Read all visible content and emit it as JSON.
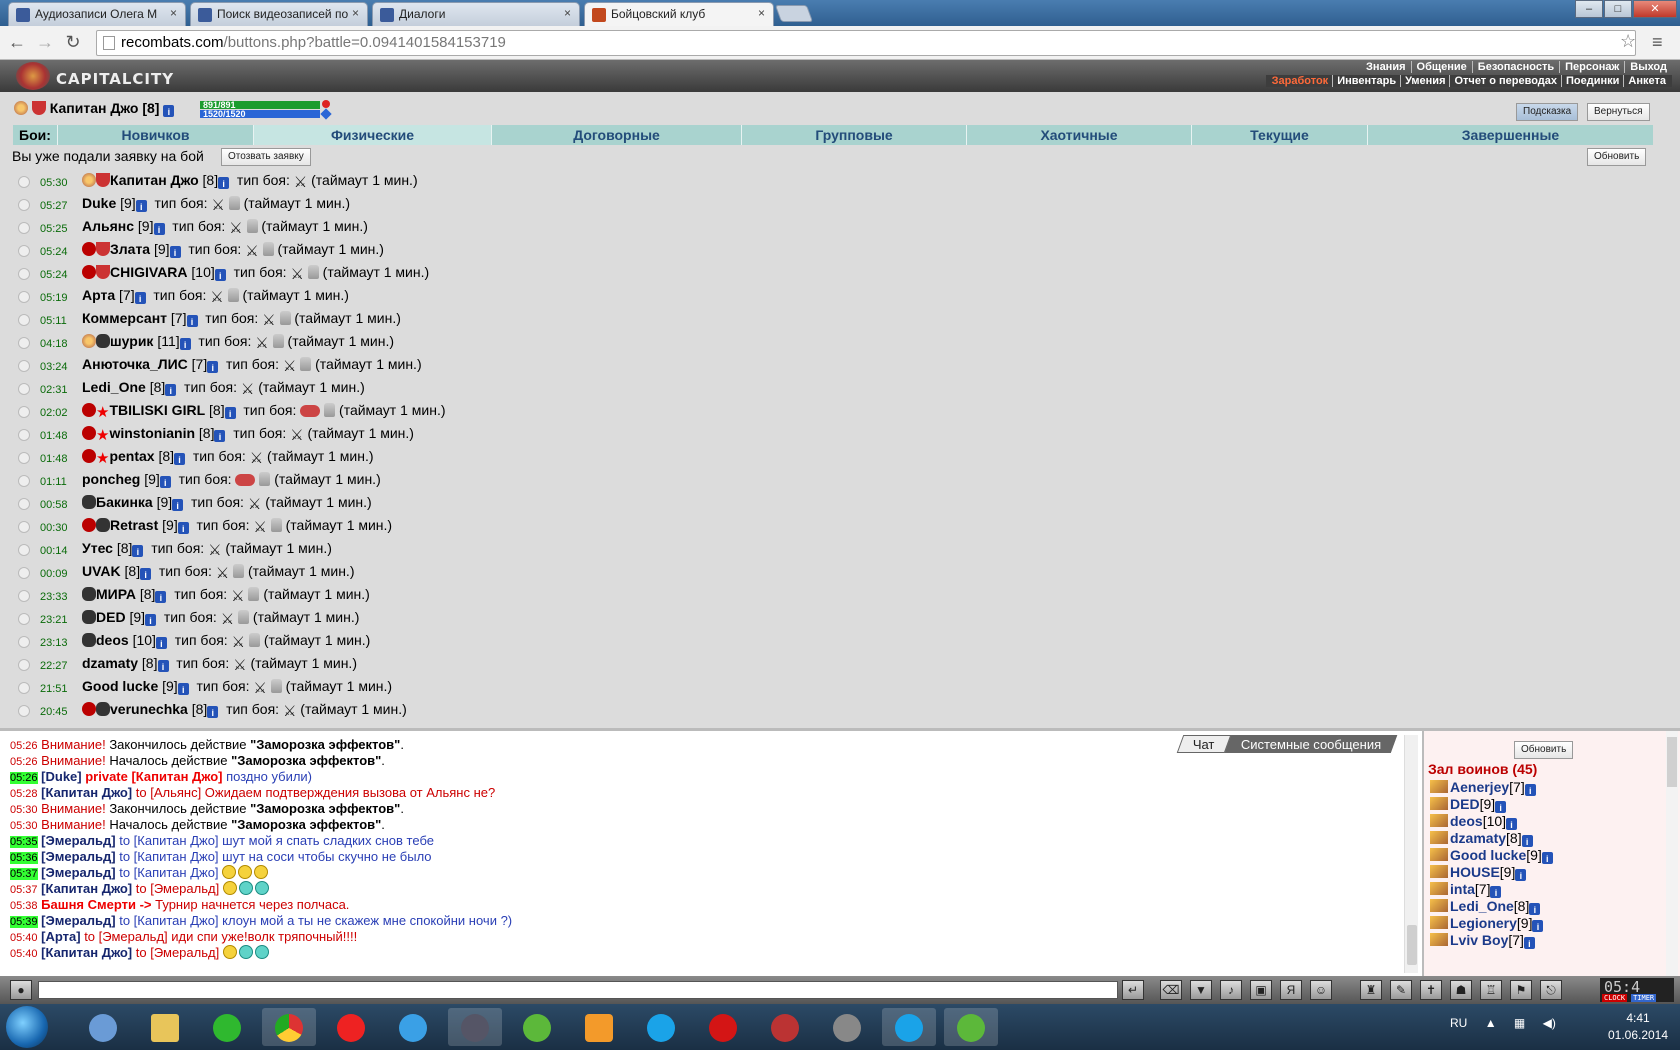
{
  "browser": {
    "tabs": [
      {
        "title": "Аудиозаписи Олега М",
        "active": false
      },
      {
        "title": "Поиск видеозаписей по",
        "active": false
      },
      {
        "title": "Диалоги",
        "active": false
      },
      {
        "title": "Бойцовский клуб",
        "active": true
      }
    ],
    "url_domain": "recombats.com",
    "url_path": "/buttons.php?battle=0.0941401584153719"
  },
  "game": {
    "logo": "CAPITALCITY",
    "topnav_row1": [
      "Знания",
      "Общение",
      "Безопасность",
      "Персонаж",
      "Выход"
    ],
    "topnav_row2": [
      "Заработок",
      "Инвентарь",
      "Умения",
      "Отчет о переводах",
      "Поединки",
      "Анкета"
    ],
    "player": {
      "name": "Капитан Джо",
      "level": "[8]",
      "hp": "891/891",
      "mana": "1520/1520"
    },
    "buttons": {
      "hint": "Подсказка",
      "back": "Вернуться",
      "refresh": "Обновить",
      "withdraw": "Отозвать заявку"
    },
    "fight_label": "Бои:",
    "fight_tabs": [
      "Новичков",
      "Физические",
      "Договорные",
      "Групповые",
      "Хаотичные",
      "Текущие",
      "Завершенные"
    ],
    "notice": "Вы уже подали заявку на бой",
    "fight_type_label": "тип боя:",
    "timeout_text": "(таймаут 1 мин.)",
    "fights": [
      {
        "time": "05:30",
        "name": "Капитан Джо",
        "level": "[8]",
        "icons": "sun-shield",
        "locked": false,
        "fist": false
      },
      {
        "time": "05:27",
        "name": "Duke",
        "level": "[9]",
        "icons": "",
        "locked": true,
        "fist": false
      },
      {
        "time": "05:25",
        "name": "Альянс",
        "level": "[9]",
        "icons": "",
        "locked": true,
        "fist": false
      },
      {
        "time": "05:24",
        "name": "Злата",
        "level": "[9]",
        "icons": "cross-shield",
        "locked": true,
        "fist": false
      },
      {
        "time": "05:24",
        "name": "CHIGIVARA",
        "level": "[10]",
        "icons": "cross-shield",
        "locked": true,
        "fist": false
      },
      {
        "time": "05:19",
        "name": "Арта",
        "level": "[7]",
        "icons": "",
        "locked": true,
        "fist": false
      },
      {
        "time": "05:11",
        "name": "Коммерсант",
        "level": "[7]",
        "icons": "",
        "locked": true,
        "fist": false
      },
      {
        "time": "04:18",
        "name": "шурик",
        "level": "[11]",
        "icons": "sun-mask",
        "locked": true,
        "fist": false
      },
      {
        "time": "03:24",
        "name": "Анюточка_ЛИС",
        "level": "[7]",
        "icons": "",
        "locked": true,
        "fist": false
      },
      {
        "time": "02:31",
        "name": "Ledi_One",
        "level": "[8]",
        "icons": "",
        "locked": false,
        "fist": false
      },
      {
        "time": "02:02",
        "name": "TBILISKI GIRL",
        "level": "[8]",
        "icons": "cross-star",
        "locked": true,
        "fist": true
      },
      {
        "time": "01:48",
        "name": "winstonianin",
        "level": "[8]",
        "icons": "cross-star",
        "locked": false,
        "fist": false
      },
      {
        "time": "01:48",
        "name": "pentax",
        "level": "[8]",
        "icons": "cross-star",
        "locked": false,
        "fist": false
      },
      {
        "time": "01:11",
        "name": "poncheg",
        "level": "[9]",
        "icons": "",
        "locked": true,
        "fist": true
      },
      {
        "time": "00:58",
        "name": "Бакинка",
        "level": "[9]",
        "icons": "mask",
        "locked": false,
        "fist": false
      },
      {
        "time": "00:30",
        "name": "Retrast",
        "level": "[9]",
        "icons": "cross-mask",
        "locked": true,
        "fist": false
      },
      {
        "time": "00:14",
        "name": "Утес",
        "level": "[8]",
        "icons": "",
        "locked": false,
        "fist": false
      },
      {
        "time": "00:09",
        "name": "UVAK",
        "level": "[8]",
        "icons": "",
        "locked": true,
        "fist": false
      },
      {
        "time": "23:33",
        "name": "МИРА",
        "level": "[8]",
        "icons": "mask",
        "locked": true,
        "fist": false
      },
      {
        "time": "23:21",
        "name": "DED",
        "level": "[9]",
        "icons": "mask",
        "locked": true,
        "fist": false
      },
      {
        "time": "23:13",
        "name": "deos",
        "level": "[10]",
        "icons": "mask",
        "locked": true,
        "fist": false
      },
      {
        "time": "22:27",
        "name": "dzamaty",
        "level": "[8]",
        "icons": "",
        "locked": false,
        "fist": false
      },
      {
        "time": "21:51",
        "name": "Good lucke",
        "level": "[9]",
        "icons": "",
        "locked": true,
        "fist": false
      },
      {
        "time": "20:45",
        "name": "verunechka",
        "level": "[8]",
        "icons": "cross-mask",
        "locked": false,
        "fist": false
      }
    ]
  },
  "chat": {
    "tabs": [
      "Чат",
      "Системные сообщения"
    ],
    "lines": [
      {
        "time": "05:26",
        "hl": false,
        "kind": "system",
        "label": "Внимание!",
        "text": " Закончилось действие ",
        "bold": "\"Заморозка эффектов\"",
        "end": "."
      },
      {
        "time": "05:26",
        "hl": false,
        "kind": "system",
        "label": "Внимание!",
        "text": " Началось действие ",
        "bold": "\"Заморозка эффектов\"",
        "end": "."
      },
      {
        "time": "05:26",
        "hl": true,
        "kind": "private",
        "from": "[Duke]",
        "to": "private [Капитан Джо]",
        "text": " поздно убили)"
      },
      {
        "time": "05:28",
        "hl": false,
        "kind": "msg",
        "from": "[Капитан Джо]",
        "to": " to [Альянс]",
        "text": " Ожидаем подтверждения вызова от Альянс не?",
        "red": true
      },
      {
        "time": "05:30",
        "hl": false,
        "kind": "system",
        "label": "Внимание!",
        "text": " Закончилось действие ",
        "bold": "\"Заморозка эффектов\"",
        "end": "."
      },
      {
        "time": "05:30",
        "hl": false,
        "kind": "system",
        "label": "Внимание!",
        "text": " Началось действие ",
        "bold": "\"Заморозка эффектов\"",
        "end": "."
      },
      {
        "time": "05:35",
        "hl": true,
        "kind": "msg",
        "from": "[Эмеральд]",
        "to": " to [Капитан Джо]",
        "text": " шут мой я спать сладких снов тебе"
      },
      {
        "time": "05:36",
        "hl": true,
        "kind": "msg",
        "from": "[Эмеральд]",
        "to": " to [Капитан Джо]",
        "text": " шут на соси чтобы скучно не было"
      },
      {
        "time": "05:37",
        "hl": true,
        "kind": "msg",
        "from": "[Эмеральд]",
        "to": " to [Капитан Джо]",
        "text": " ",
        "smiles": 3
      },
      {
        "time": "05:37",
        "hl": false,
        "kind": "msg",
        "from": "[Капитан Джо]",
        "to": " to [Эмеральд]",
        "text": " ",
        "smiles": 3,
        "red": true
      },
      {
        "time": "05:38",
        "hl": false,
        "kind": "tower",
        "from": "Башня Смерти ->",
        "text": " Турнир начнется через полчаса."
      },
      {
        "time": "05:39",
        "hl": true,
        "kind": "msg",
        "from": "[Эмеральд]",
        "to": " to [Капитан Джо]",
        "text": " клоун мой а ты не скажеж мне спокойни ночи ?)"
      },
      {
        "time": "05:40",
        "hl": false,
        "kind": "msg",
        "from": "[Арта]",
        "to": " to [Эмеральд]",
        "text": " иди спи уже!волк тряпочный!!!!",
        "red": true
      },
      {
        "time": "05:40",
        "hl": false,
        "kind": "msg",
        "from": "[Капитан Джо]",
        "to": " to [Эмеральд]",
        "text": " ",
        "smiles": 3,
        "red": true
      }
    ]
  },
  "userlist": {
    "refresh": "Обновить",
    "title": "Зал воинов (45)",
    "users": [
      {
        "name": "Aenerjey",
        "level": "[7]"
      },
      {
        "name": "DED",
        "level": "[9]"
      },
      {
        "name": "deos",
        "level": "[10]"
      },
      {
        "name": "dzamaty",
        "level": "[8]"
      },
      {
        "name": "Good lucke",
        "level": "[9]"
      },
      {
        "name": "HOUSE",
        "level": "[9]"
      },
      {
        "name": "inta",
        "level": "[7]"
      },
      {
        "name": "Ledi_One",
        "level": "[8]"
      },
      {
        "name": "Legionery",
        "level": "[9]"
      },
      {
        "name": "Lviv Boy",
        "level": "[7]"
      }
    ]
  },
  "gameclock": {
    "time": "05:4",
    "clock_label": "CLOCK",
    "timer_label": "TIMER"
  },
  "taskbar": {
    "lang": "RU",
    "time": "4:41",
    "date": "01.06.2014"
  }
}
